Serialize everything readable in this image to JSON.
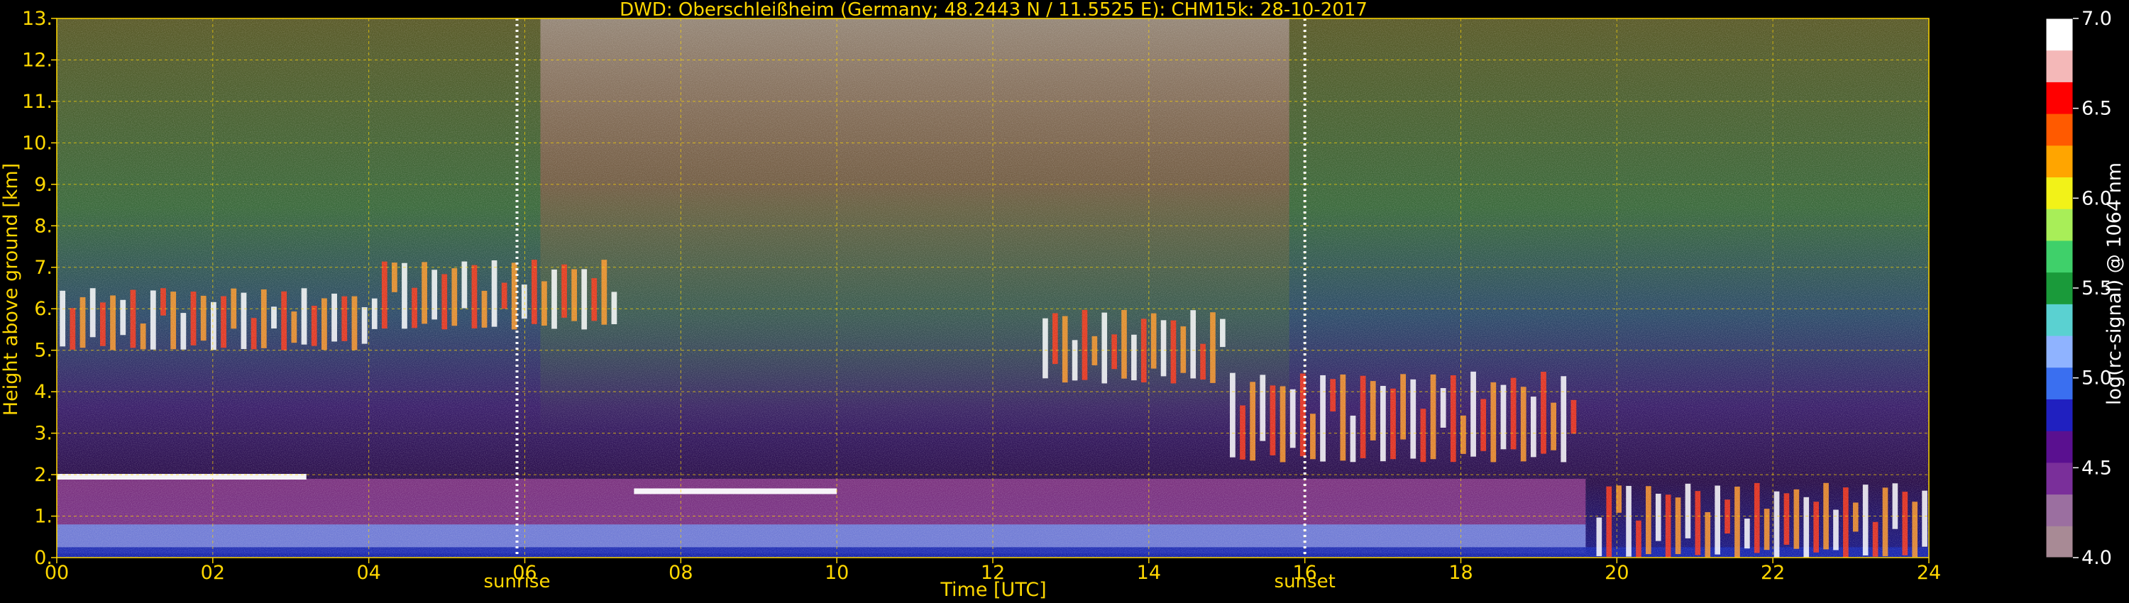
{
  "chart_data": {
    "type": "heatmap",
    "title": "DWD: Oberschleißheim (Germany; 48.2443 N / 11.5525 E):    CHM15k: 28-10-2017",
    "xlabel": "Time [UTC]",
    "ylabel": "Height above ground [km]",
    "colorbar_label": "log(rc-signal) @ 1064 nm",
    "xlim": [
      0,
      24
    ],
    "ylim": [
      0,
      13
    ],
    "x_ticks": [
      0,
      2,
      4,
      6,
      8,
      10,
      12,
      14,
      16,
      18,
      20,
      22,
      24
    ],
    "x_tick_labels": [
      "00",
      "02",
      "04",
      "06",
      "08",
      "10",
      "12",
      "14",
      "16",
      "18",
      "20",
      "22",
      "24"
    ],
    "y_ticks": [
      0,
      1,
      2,
      3,
      4,
      5,
      6,
      7,
      8,
      9,
      10,
      11,
      12,
      13
    ],
    "y_tick_labels": [
      "0.",
      "1.",
      "2.",
      "3.",
      "4.",
      "5.",
      "6.",
      "7.",
      "8.",
      "9.",
      "10.",
      "11.",
      "12.",
      "13."
    ],
    "colorbar_range": [
      4.0,
      7.0
    ],
    "colorbar_ticks": [
      4.0,
      4.5,
      5.0,
      5.5,
      6.0,
      6.5,
      7.0
    ],
    "colorbar_tick_labels": [
      "4.0",
      "4.5",
      "5.0",
      "5.5",
      "6.0",
      "6.5",
      "7.0"
    ],
    "colormap": [
      "#a88a95",
      "#9b6fa0",
      "#7a2f9a",
      "#5a1090",
      "#2020c0",
      "#3a6ff0",
      "#8fb3ff",
      "#5ad1d1",
      "#1a9a3a",
      "#3fd06a",
      "#a8ee58",
      "#f2f218",
      "#ffa500",
      "#ff5a00",
      "#ff0000",
      "#f4b8b8",
      "#ffffff"
    ],
    "grid": true,
    "vertical_markers": [
      {
        "x": 5.9,
        "label": "sunrise"
      },
      {
        "x": 16.0,
        "label": "sunset"
      }
    ],
    "cloud_layers": [
      {
        "x": [
          0.0,
          3.2
        ],
        "y": 1.95,
        "desc_value": 7.0
      },
      {
        "x": [
          7.4,
          10.0
        ],
        "y": 1.6,
        "desc_value": 7.0
      },
      {
        "x": [
          0.0,
          4.0
        ],
        "y_range": [
          5.0,
          6.5
        ],
        "desc_value": 6.5
      },
      {
        "x": [
          4.0,
          7.2
        ],
        "y_range": [
          5.5,
          7.2
        ],
        "desc_value": 6.5
      },
      {
        "x": [
          12.6,
          15.0
        ],
        "y_range": [
          4.2,
          6.0
        ],
        "desc_value": 7.0
      },
      {
        "x": [
          15.0,
          19.5
        ],
        "y_range": [
          2.3,
          4.5
        ],
        "desc_value": 7.0
      },
      {
        "x": [
          19.7,
          24.0
        ],
        "y_range": [
          0.0,
          1.8
        ],
        "desc_value": 7.0
      }
    ]
  }
}
